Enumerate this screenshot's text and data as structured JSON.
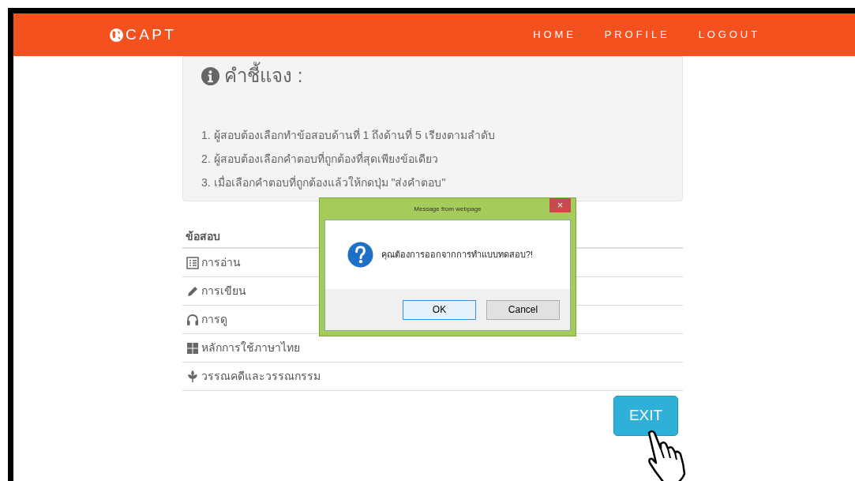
{
  "navbar": {
    "brand": "CAPT",
    "links": [
      "HOME",
      "PROFILE",
      "LOGOUT"
    ]
  },
  "instructions": {
    "title": "คำชี้แจง :",
    "items": [
      "1. ผู้สอบต้องเลือกทำข้อสอบด้านที่ 1 ถึงด้านที่ 5 เรียงตามลำดับ",
      "2. ผู้สอบต้องเลือกคำตอบที่ถูกต้องที่สุดเพียงข้อเดียว",
      "3. เมื่อเลือกคำตอบที่ถูกต้องแล้วให้กดปุ่ม \"ส่งคำตอบ\""
    ]
  },
  "exam_table": {
    "header": "ข้อสอบ",
    "rows": [
      {
        "kind": "list",
        "label": "การอ่าน"
      },
      {
        "kind": "pencil",
        "label": "การเขียน"
      },
      {
        "kind": "headphones",
        "label": "การดู"
      },
      {
        "kind": "grid",
        "label": "หลักการใช้ภาษาไทย"
      },
      {
        "kind": "leaf",
        "label": "วรรณคดีและวรรณกรรม"
      }
    ]
  },
  "exit_button": "EXIT",
  "dialog": {
    "title": "Message from webpage",
    "close": "×",
    "message": "คุณต้องการออกจากการทำแบบทดสอบ?!",
    "buttons": [
      {
        "label": "OK",
        "selected": true
      },
      {
        "label": "Cancel",
        "selected": false
      }
    ]
  }
}
